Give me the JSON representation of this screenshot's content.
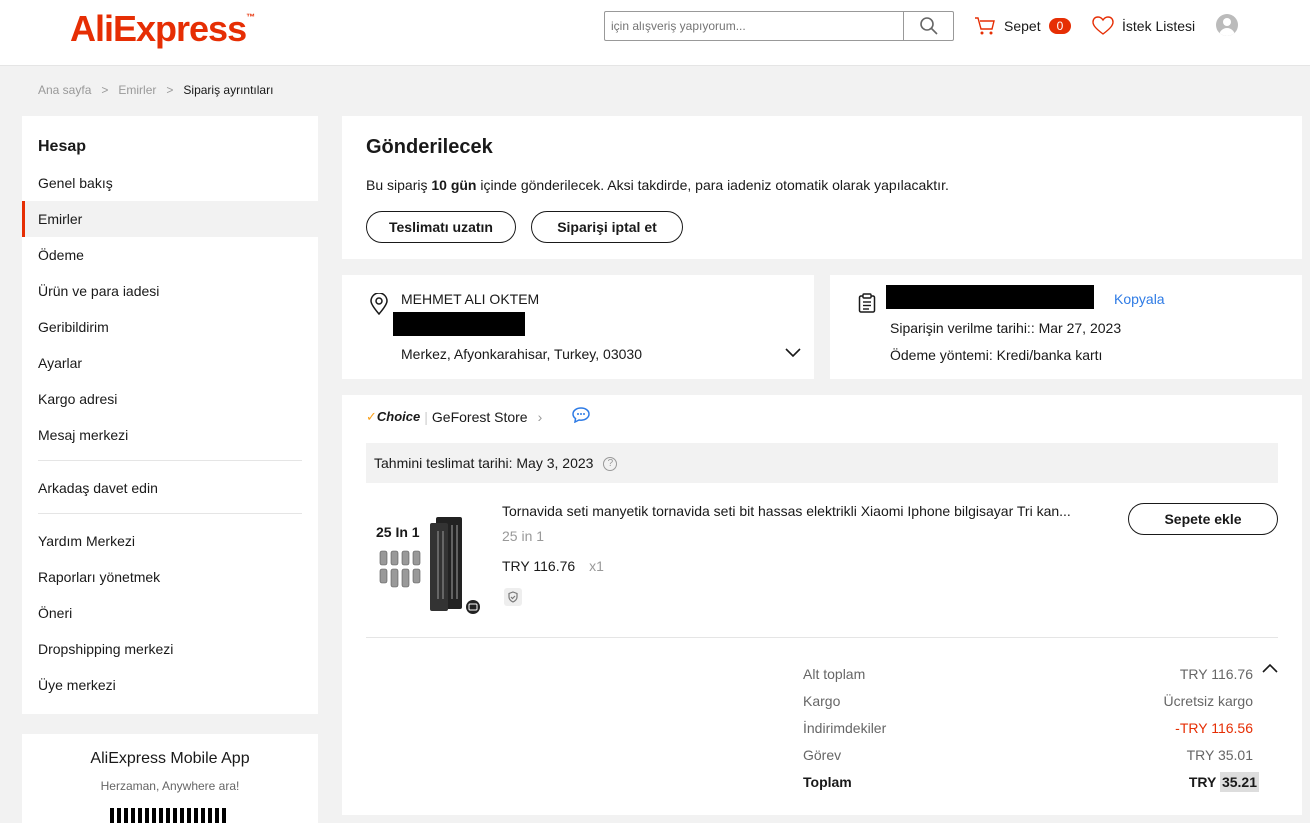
{
  "header": {
    "logo": "AliExpress",
    "search_placeholder": "için alışveriş yapıyorum...",
    "cart_label": "Sepet",
    "cart_count": "0",
    "wishlist_label": "İstek Listesi"
  },
  "breadcrumb": [
    "Ana sayfa",
    "Emirler",
    "Sipariş ayrıntıları"
  ],
  "sidebar": {
    "title": "Hesap",
    "items": [
      "Genel bakış",
      "Emirler",
      "Ödeme",
      "Ürün ve para iadesi",
      "Geribildirim",
      "Ayarlar",
      "Kargo adresi",
      "Mesaj merkezi"
    ],
    "items2": [
      "Arkadaş davet edin"
    ],
    "items3": [
      "Yardım Merkezi",
      "Raporları yönetmek",
      "Öneri",
      "Dropshipping merkezi",
      "Üye merkezi"
    ]
  },
  "app": {
    "title": "AliExpress Mobile App",
    "subtitle": "Herzaman, Anywhere ara!"
  },
  "status": {
    "title": "Gönderilecek",
    "text_prefix": "Bu sipariş",
    "text_bold": "10 gün",
    "text_suffix": "içinde gönderilecek. Aksi takdirde, para iadeniz otomatik olarak yapılacaktır.",
    "extend_button": "Teslimatı uzatın",
    "cancel_button": "Siparişi iptal et"
  },
  "address": {
    "name": "MEHMET ALI OKTEM",
    "line": "Merkez, Afyonkarahisar, Turkey, 03030"
  },
  "order": {
    "copy_label": "Kopyala",
    "placed_label": "Siparişin verilme tarihi::",
    "placed_date": "Mar 27, 2023",
    "payment_label": "Ödeme yöntemi:",
    "payment_value": "Kredi/banka kartı"
  },
  "store": {
    "choice_label": "Choice",
    "name": "GeForest Store",
    "eta_label": "Tahmini teslimat tarihi:",
    "eta_date": "May 3, 2023"
  },
  "product": {
    "image_text": "25 In 1",
    "title": "Tornavida seti manyetik tornavida seti bit hassas elektrikli Xiaomi Iphone bilgisayar Tri kan...",
    "sku": "25 in 1",
    "price": "TRY 116.76",
    "qty": "x1",
    "add_button": "Sepete ekle"
  },
  "summary": {
    "rows": [
      {
        "label": "Alt toplam",
        "value": "TRY 116.76"
      },
      {
        "label": "Kargo",
        "value": "Ücretsiz kargo"
      },
      {
        "label": "İndirimdekiler",
        "value": "-TRY 116.56"
      },
      {
        "label": "Görev",
        "value": "TRY 35.01"
      }
    ],
    "total_label": "Toplam",
    "total_currency": "TRY",
    "total_value": "35.21"
  },
  "colors": {
    "brand": "#e62e04",
    "link": "#2e7be5",
    "choice": "#f9a01b"
  }
}
